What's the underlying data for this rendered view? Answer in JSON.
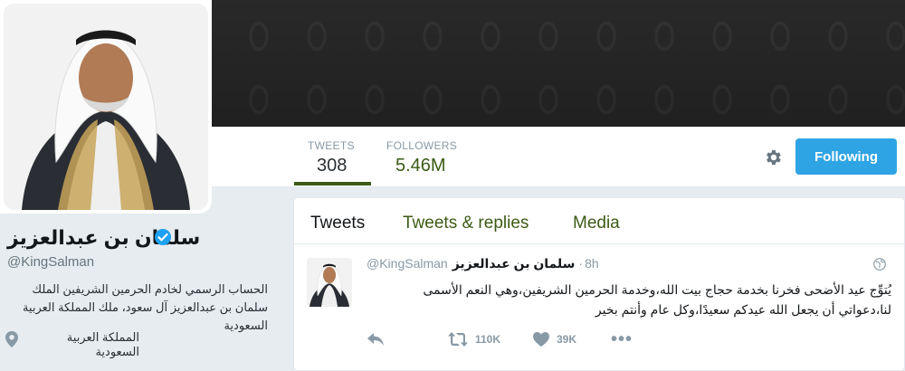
{
  "header": {
    "stats": [
      {
        "label": "TWEETS",
        "value": "308"
      },
      {
        "label": "FOLLOWERS",
        "value": "5.46M"
      }
    ],
    "follow_button_label": "Following"
  },
  "profile": {
    "name": "سلمان بن عبدالعزيز",
    "handle": "@KingSalman",
    "bio": "الحساب الرسمي لخادم الحرمين الشريفين الملك سلمان بن عبدالعزيز آل سعود، ملك المملكة العربية السعودية",
    "location": "المملكة العربية السعودية"
  },
  "timeline": {
    "tabs": [
      "Tweets",
      "Tweets & replies",
      "Media"
    ],
    "tweet": {
      "handle": "@KingSalman",
      "name": "سلمان بن عبدالعزيز",
      "separator": "·",
      "time": "8h",
      "text": "يُتوِّج عيد الأضحى فخرنا بخدمة حجاج بيت الله،وخدمة الحرمين الشريفين،وهي النعم الأسمى لنا،دعواتي أن يجعل الله عيدكم سعيدًا،وكل عام وأنتم بخير",
      "retweets": "110K",
      "likes": "39K",
      "more": "•••"
    }
  },
  "icons": {
    "settings": "gear-icon",
    "verified": "verified-badge-icon",
    "location": "location-pin-icon",
    "globe": "globe-icon",
    "reply": "reply-icon",
    "retweet": "retweet-icon",
    "like": "heart-icon"
  },
  "colors": {
    "accent": "#3c5b15",
    "follow_button": "#2fa4e4",
    "verified": "#1da1f2"
  }
}
